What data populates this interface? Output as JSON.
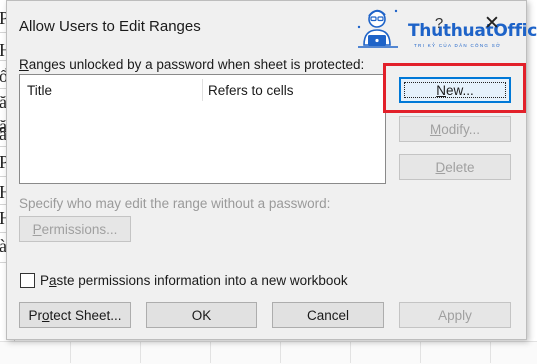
{
  "dialog": {
    "title": "Allow Users to Edit Ranges",
    "help_glyph": "?",
    "close_glyph": "✕"
  },
  "watermark": {
    "brand": "ThuthuatOffice",
    "tagline": "TRI KỶ CỦA DÂN CÔNG SỞ"
  },
  "ranges": {
    "label_pre": "R",
    "label_post": "anges unlocked by a password when sheet is protected:",
    "columns": [
      "Title",
      "Refers to cells"
    ]
  },
  "buttons": {
    "new_u": "N",
    "new_rest": "ew...",
    "modify_u": "M",
    "modify_rest": "odify...",
    "delete_u": "D",
    "delete_rest": "elete",
    "permissions_u": "P",
    "permissions_rest": "ermissions...",
    "protect_pre": "Pr",
    "protect_u": "o",
    "protect_rest": "tect Sheet...",
    "ok": "OK",
    "cancel": "Cancel",
    "apply": "Apply"
  },
  "specify_label": "Specify who may edit the range without a password:",
  "paste_checkbox": {
    "pre": "P",
    "u": "a",
    "rest": "ste permissions information into a new workbook",
    "checked": false
  },
  "sheet_bg_chars": [
    "P",
    "H",
    "ổ",
    "ă",
    "ă",
    "â",
    "P",
    "H",
    "H",
    "à"
  ],
  "colors": {
    "accent": "#0078d7",
    "highlight": "#e2202a",
    "brand": "#1e63c8"
  }
}
